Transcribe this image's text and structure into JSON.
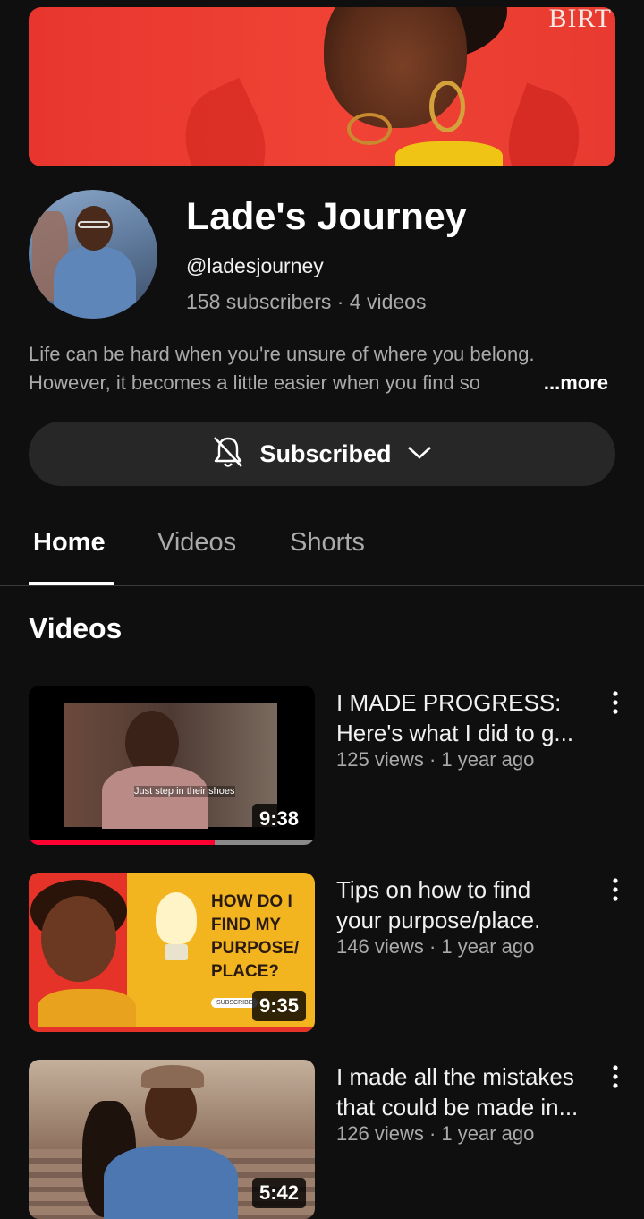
{
  "banner": {
    "text": "BIRT"
  },
  "channel": {
    "name": "Lade's Journey",
    "handle": "@ladesjourney",
    "stats": "158 subscribers · 4 videos",
    "description_line1": "Life can be hard when you're unsure of where you belong.",
    "description_line2": "However, it becomes a little easier when you find so",
    "more_label": "...more"
  },
  "subscribe_button": {
    "label": "Subscribed",
    "bell_icon": "bell-off-icon",
    "chevron_icon": "chevron-down-icon"
  },
  "tabs": [
    {
      "label": "Home",
      "active": true
    },
    {
      "label": "Videos",
      "active": false
    },
    {
      "label": "Shorts",
      "active": false
    }
  ],
  "section": {
    "title": "Videos"
  },
  "videos": [
    {
      "title_line1": "I MADE PROGRESS:",
      "title_line2": "Here's what I did to g...",
      "meta": "125 views · 1 year ago",
      "duration": "9:38",
      "caption": "Just step in their shoes",
      "watch_progress": 0.65
    },
    {
      "title_line1": "Tips on how to find",
      "title_line2": "your purpose/place.",
      "meta": "146 views · 1 year ago",
      "duration": "9:35",
      "thumb_text_1": "HOW DO I",
      "thumb_text_2": "FIND MY",
      "thumb_text_3": "PURPOSE/",
      "thumb_text_4": "PLACE?",
      "thumb_subscribe": "SUBSCRIBE"
    },
    {
      "title_line1": "I made all the mistakes",
      "title_line2": "that could be made in...",
      "meta": "126 views · 1 year ago",
      "duration": "5:42"
    }
  ],
  "colors": {
    "background": "#0f0f0f",
    "accent_red": "#ff0033",
    "button_bg": "#272727"
  }
}
